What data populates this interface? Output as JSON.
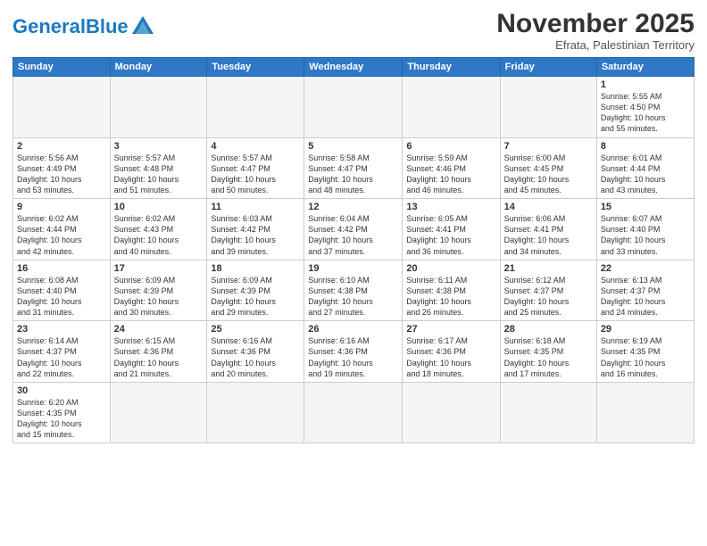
{
  "header": {
    "logo_general": "General",
    "logo_blue": "Blue",
    "month_title": "November 2025",
    "subtitle": "Efrata, Palestinian Territory"
  },
  "weekdays": [
    "Sunday",
    "Monday",
    "Tuesday",
    "Wednesday",
    "Thursday",
    "Friday",
    "Saturday"
  ],
  "weeks": [
    [
      {
        "day": "",
        "info": ""
      },
      {
        "day": "",
        "info": ""
      },
      {
        "day": "",
        "info": ""
      },
      {
        "day": "",
        "info": ""
      },
      {
        "day": "",
        "info": ""
      },
      {
        "day": "",
        "info": ""
      },
      {
        "day": "1",
        "info": "Sunrise: 5:55 AM\nSunset: 4:50 PM\nDaylight: 10 hours\nand 55 minutes."
      }
    ],
    [
      {
        "day": "2",
        "info": "Sunrise: 5:56 AM\nSunset: 4:49 PM\nDaylight: 10 hours\nand 53 minutes."
      },
      {
        "day": "3",
        "info": "Sunrise: 5:57 AM\nSunset: 4:48 PM\nDaylight: 10 hours\nand 51 minutes."
      },
      {
        "day": "4",
        "info": "Sunrise: 5:57 AM\nSunset: 4:47 PM\nDaylight: 10 hours\nand 50 minutes."
      },
      {
        "day": "5",
        "info": "Sunrise: 5:58 AM\nSunset: 4:47 PM\nDaylight: 10 hours\nand 48 minutes."
      },
      {
        "day": "6",
        "info": "Sunrise: 5:59 AM\nSunset: 4:46 PM\nDaylight: 10 hours\nand 46 minutes."
      },
      {
        "day": "7",
        "info": "Sunrise: 6:00 AM\nSunset: 4:45 PM\nDaylight: 10 hours\nand 45 minutes."
      },
      {
        "day": "8",
        "info": "Sunrise: 6:01 AM\nSunset: 4:44 PM\nDaylight: 10 hours\nand 43 minutes."
      }
    ],
    [
      {
        "day": "9",
        "info": "Sunrise: 6:02 AM\nSunset: 4:44 PM\nDaylight: 10 hours\nand 42 minutes."
      },
      {
        "day": "10",
        "info": "Sunrise: 6:02 AM\nSunset: 4:43 PM\nDaylight: 10 hours\nand 40 minutes."
      },
      {
        "day": "11",
        "info": "Sunrise: 6:03 AM\nSunset: 4:42 PM\nDaylight: 10 hours\nand 39 minutes."
      },
      {
        "day": "12",
        "info": "Sunrise: 6:04 AM\nSunset: 4:42 PM\nDaylight: 10 hours\nand 37 minutes."
      },
      {
        "day": "13",
        "info": "Sunrise: 6:05 AM\nSunset: 4:41 PM\nDaylight: 10 hours\nand 36 minutes."
      },
      {
        "day": "14",
        "info": "Sunrise: 6:06 AM\nSunset: 4:41 PM\nDaylight: 10 hours\nand 34 minutes."
      },
      {
        "day": "15",
        "info": "Sunrise: 6:07 AM\nSunset: 4:40 PM\nDaylight: 10 hours\nand 33 minutes."
      }
    ],
    [
      {
        "day": "16",
        "info": "Sunrise: 6:08 AM\nSunset: 4:40 PM\nDaylight: 10 hours\nand 31 minutes."
      },
      {
        "day": "17",
        "info": "Sunrise: 6:09 AM\nSunset: 4:39 PM\nDaylight: 10 hours\nand 30 minutes."
      },
      {
        "day": "18",
        "info": "Sunrise: 6:09 AM\nSunset: 4:39 PM\nDaylight: 10 hours\nand 29 minutes."
      },
      {
        "day": "19",
        "info": "Sunrise: 6:10 AM\nSunset: 4:38 PM\nDaylight: 10 hours\nand 27 minutes."
      },
      {
        "day": "20",
        "info": "Sunrise: 6:11 AM\nSunset: 4:38 PM\nDaylight: 10 hours\nand 26 minutes."
      },
      {
        "day": "21",
        "info": "Sunrise: 6:12 AM\nSunset: 4:37 PM\nDaylight: 10 hours\nand 25 minutes."
      },
      {
        "day": "22",
        "info": "Sunrise: 6:13 AM\nSunset: 4:37 PM\nDaylight: 10 hours\nand 24 minutes."
      }
    ],
    [
      {
        "day": "23",
        "info": "Sunrise: 6:14 AM\nSunset: 4:37 PM\nDaylight: 10 hours\nand 22 minutes."
      },
      {
        "day": "24",
        "info": "Sunrise: 6:15 AM\nSunset: 4:36 PM\nDaylight: 10 hours\nand 21 minutes."
      },
      {
        "day": "25",
        "info": "Sunrise: 6:16 AM\nSunset: 4:36 PM\nDaylight: 10 hours\nand 20 minutes."
      },
      {
        "day": "26",
        "info": "Sunrise: 6:16 AM\nSunset: 4:36 PM\nDaylight: 10 hours\nand 19 minutes."
      },
      {
        "day": "27",
        "info": "Sunrise: 6:17 AM\nSunset: 4:36 PM\nDaylight: 10 hours\nand 18 minutes."
      },
      {
        "day": "28",
        "info": "Sunrise: 6:18 AM\nSunset: 4:35 PM\nDaylight: 10 hours\nand 17 minutes."
      },
      {
        "day": "29",
        "info": "Sunrise: 6:19 AM\nSunset: 4:35 PM\nDaylight: 10 hours\nand 16 minutes."
      }
    ],
    [
      {
        "day": "30",
        "info": "Sunrise: 6:20 AM\nSunset: 4:35 PM\nDaylight: 10 hours\nand 15 minutes."
      },
      {
        "day": "",
        "info": ""
      },
      {
        "day": "",
        "info": ""
      },
      {
        "day": "",
        "info": ""
      },
      {
        "day": "",
        "info": ""
      },
      {
        "day": "",
        "info": ""
      },
      {
        "day": "",
        "info": ""
      }
    ]
  ]
}
